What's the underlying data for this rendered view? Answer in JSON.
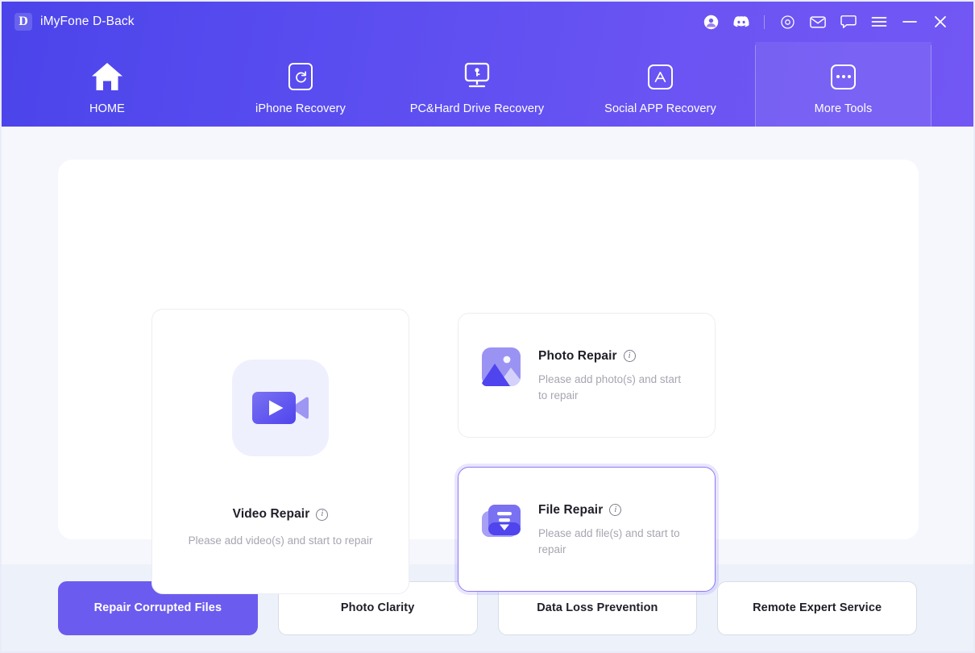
{
  "window": {
    "brand_mark": "D",
    "title": "iMyFone D-Back",
    "titlebar_icons": [
      {
        "name": "account-avatar-icon",
        "label": "Account"
      },
      {
        "name": "discord-icon",
        "label": "Discord"
      },
      {
        "name": "target-record-icon",
        "label": "Record"
      },
      {
        "name": "mail-icon",
        "label": "Mail"
      },
      {
        "name": "chat-icon",
        "label": "Feedback"
      },
      {
        "name": "hamburger-menu-icon",
        "label": "Menu"
      },
      {
        "name": "minimize-icon",
        "label": "Minimize"
      },
      {
        "name": "close-icon",
        "label": "Close"
      }
    ]
  },
  "nav": {
    "items": [
      {
        "label": "HOME",
        "icon": "home-icon",
        "active": false
      },
      {
        "label": "iPhone Recovery",
        "icon": "phone-refresh-icon",
        "active": false
      },
      {
        "label": "PC&Hard Drive Recovery",
        "icon": "monitor-key-icon",
        "active": false
      },
      {
        "label": "Social APP Recovery",
        "icon": "appstore-icon",
        "active": false
      },
      {
        "label": "More Tools",
        "icon": "more-dots-icon",
        "active": true
      }
    ]
  },
  "main": {
    "cards": [
      {
        "id": "video-repair",
        "title": "Video Repair",
        "desc": "Please add video(s) and start to repair",
        "icon": "video-camera-icon",
        "selected": false
      },
      {
        "id": "photo-repair",
        "title": "Photo Repair",
        "desc": "Please add photo(s) and start to repair",
        "icon": "photo-image-icon",
        "selected": false
      },
      {
        "id": "file-repair",
        "title": "File Repair",
        "desc": "Please add file(s) and start to repair",
        "icon": "file-document-icon",
        "selected": true
      }
    ],
    "info_glyph": "i"
  },
  "footer": {
    "buttons": [
      {
        "label": "Repair Corrupted Files",
        "primary": true
      },
      {
        "label": "Photo Clarity",
        "primary": false
      },
      {
        "label": "Data Loss Prevention",
        "primary": false
      },
      {
        "label": "Remote Expert Service",
        "primary": false
      }
    ]
  },
  "colors": {
    "header_start": "#4b44ea",
    "header_end": "#7257f4",
    "accent": "#6c5bef",
    "page_bg": "#f6f7fc",
    "footer_bg": "#edf1fa",
    "selected_border": "#8d7af5",
    "icon_tile_bg": "#eef0fd",
    "muted_text": "#a6a6b2"
  }
}
